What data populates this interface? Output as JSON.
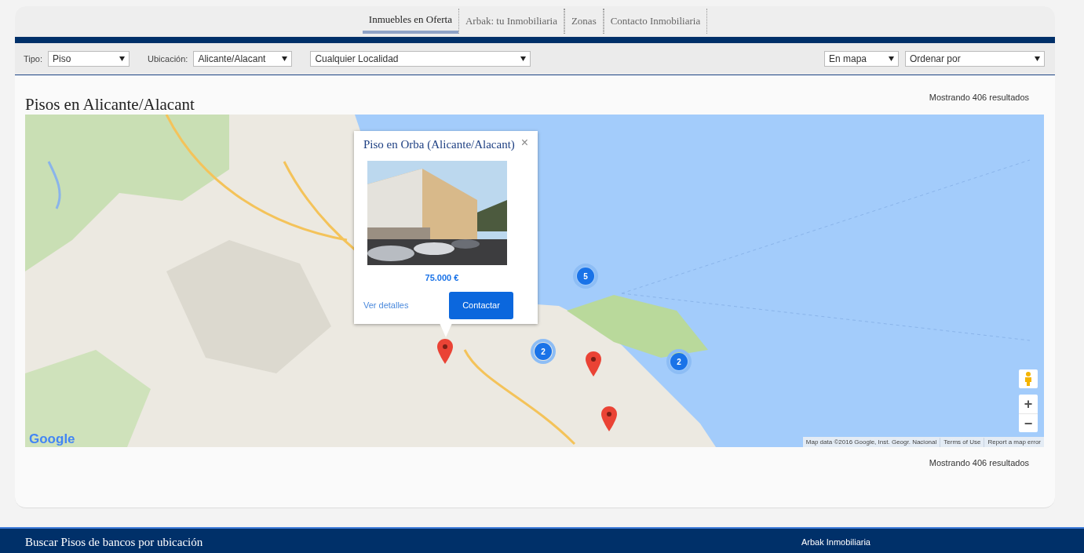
{
  "tabs": [
    {
      "label": "Inmuebles en Oferta",
      "selected": true
    },
    {
      "label": "Arbak: tu Inmobiliaria",
      "selected": false
    },
    {
      "label": "Zonas",
      "selected": false
    },
    {
      "label": "Contacto Inmobiliaria",
      "selected": false
    }
  ],
  "filters_left": [
    {
      "label": "Tipo:",
      "value": "Piso"
    },
    {
      "label": "Ubicación:",
      "value": "Alicante/Alacant"
    },
    {
      "value": "Cualquier Localidad"
    }
  ],
  "filters_right": [
    {
      "value": "En mapa"
    },
    {
      "value": "Ordenar por"
    }
  ],
  "heading": "Pisos en Alicante/Alacant",
  "results_top": "Mostrando 406 resultados",
  "map": {
    "clusters": [
      {
        "count": "5"
      },
      {
        "count": "2"
      },
      {
        "count": "2"
      }
    ],
    "popup": {
      "title": "Piso en Orba (Alicante/Alacant)",
      "close": "×",
      "price": "75.000 €",
      "details_link": "Ver detalles",
      "contact_button": "Contactar"
    },
    "zoom_in": "+",
    "zoom_out": "−",
    "logo": "Google",
    "attribution": [
      "Map data ©2016 Google, Inst. Geogr. Nacional",
      "Terms of Use",
      "Report a map error"
    ]
  },
  "results_bottom": "Mostrando 406 resultados",
  "footer": {
    "heading": "Buscar Pisos de bancos por ubicación",
    "column_title": "Arbak Inmobiliaria"
  }
}
